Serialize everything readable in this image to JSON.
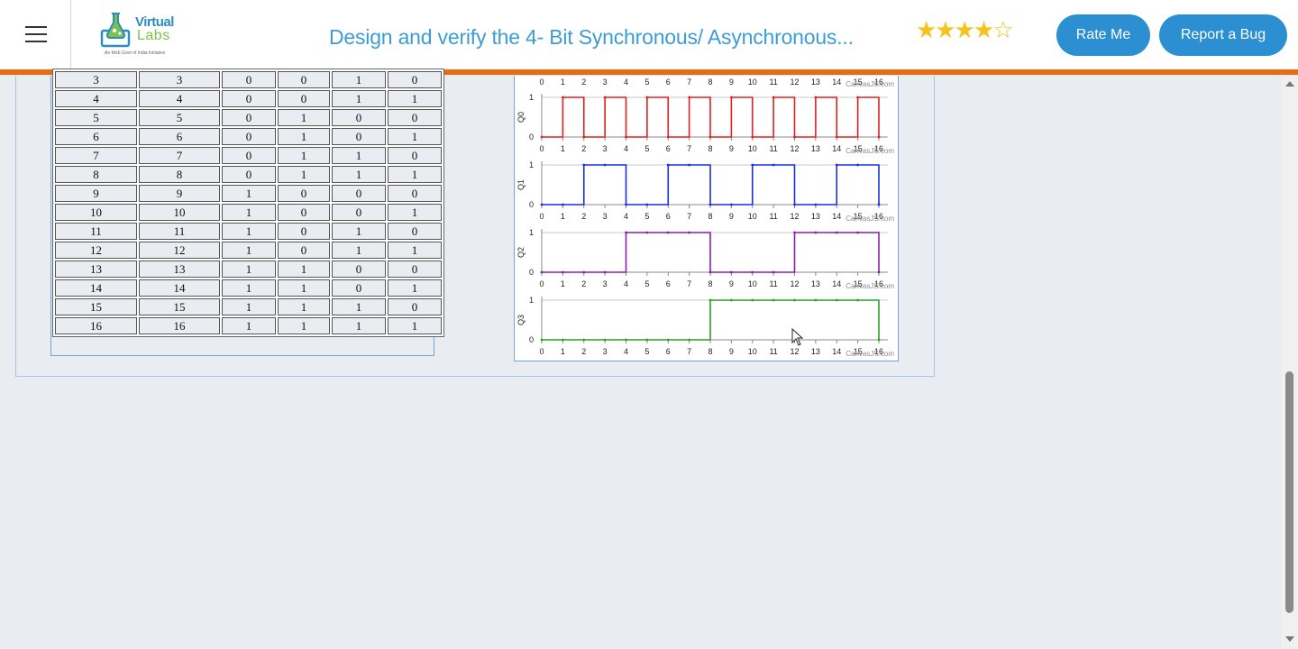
{
  "header": {
    "menu_icon": "hamburger-menu-icon",
    "logo": {
      "word1": "Virtual",
      "word2": "Labs",
      "tagline": "An MoE Govt of India Initiative"
    },
    "title": "Design and verify the 4- Bit Synchronous/ Asynchronous...",
    "rating": {
      "filled": 4,
      "total": 5,
      "filled_glyph": "★★★★",
      "empty_glyph": "☆"
    },
    "rate_button": "Rate Me",
    "bug_button": "Report a Bug",
    "colors": {
      "accent_bar": "#ec6a10",
      "button": "#2b8fd1",
      "title": "#3b9dd4",
      "star": "#f6c21c"
    }
  },
  "truth_table": {
    "rows": [
      [
        "3",
        "3",
        "0",
        "0",
        "1",
        "0"
      ],
      [
        "4",
        "4",
        "0",
        "0",
        "1",
        "1"
      ],
      [
        "5",
        "5",
        "0",
        "1",
        "0",
        "0"
      ],
      [
        "6",
        "6",
        "0",
        "1",
        "0",
        "1"
      ],
      [
        "7",
        "7",
        "0",
        "1",
        "1",
        "0"
      ],
      [
        "8",
        "8",
        "0",
        "1",
        "1",
        "1"
      ],
      [
        "9",
        "9",
        "1",
        "0",
        "0",
        "0"
      ],
      [
        "10",
        "10",
        "1",
        "0",
        "0",
        "1"
      ],
      [
        "11",
        "11",
        "1",
        "0",
        "1",
        "0"
      ],
      [
        "12",
        "12",
        "1",
        "0",
        "1",
        "1"
      ],
      [
        "13",
        "13",
        "1",
        "1",
        "0",
        "0"
      ],
      [
        "14",
        "14",
        "1",
        "1",
        "0",
        "1"
      ],
      [
        "15",
        "15",
        "1",
        "1",
        "1",
        "0"
      ],
      [
        "16",
        "16",
        "1",
        "1",
        "1",
        "1"
      ]
    ]
  },
  "chart_data": [
    {
      "type": "line",
      "step": true,
      "ylabel": "Q0",
      "color": "#e02020",
      "watermark": "CanvasJS.com",
      "x": [
        0,
        1,
        2,
        3,
        4,
        5,
        6,
        7,
        8,
        9,
        10,
        11,
        12,
        13,
        14,
        15,
        16
      ],
      "values": [
        0,
        1,
        0,
        1,
        0,
        1,
        0,
        1,
        0,
        1,
        0,
        1,
        0,
        1,
        0,
        1,
        0
      ],
      "ylim": [
        0,
        1
      ],
      "xlim": [
        0,
        16
      ],
      "xticks": [
        "0",
        "1",
        "2",
        "3",
        "4",
        "5",
        "6",
        "7",
        "8",
        "9",
        "10",
        "11",
        "12",
        "13",
        "14",
        "15",
        "16"
      ],
      "yticks": [
        "0",
        "1"
      ]
    },
    {
      "type": "line",
      "step": true,
      "ylabel": "Q1",
      "color": "#1a2ee0",
      "watermark": "CanvasJS.com",
      "x": [
        0,
        1,
        2,
        3,
        4,
        5,
        6,
        7,
        8,
        9,
        10,
        11,
        12,
        13,
        14,
        15,
        16
      ],
      "values": [
        0,
        0,
        1,
        1,
        0,
        0,
        1,
        1,
        0,
        0,
        1,
        1,
        0,
        0,
        1,
        1,
        0
      ],
      "ylim": [
        0,
        1
      ],
      "xlim": [
        0,
        16
      ],
      "xticks": [
        "0",
        "1",
        "2",
        "3",
        "4",
        "5",
        "6",
        "7",
        "8",
        "9",
        "10",
        "11",
        "12",
        "13",
        "14",
        "15",
        "16"
      ],
      "yticks": [
        "0",
        "1"
      ]
    },
    {
      "type": "line",
      "step": true,
      "ylabel": "Q2",
      "color": "#8a1eb0",
      "watermark": "CanvasJS.com",
      "x": [
        0,
        1,
        2,
        3,
        4,
        5,
        6,
        7,
        8,
        9,
        10,
        11,
        12,
        13,
        14,
        15,
        16
      ],
      "values": [
        0,
        0,
        0,
        0,
        1,
        1,
        1,
        1,
        0,
        0,
        0,
        0,
        1,
        1,
        1,
        1,
        0
      ],
      "ylim": [
        0,
        1
      ],
      "xlim": [
        0,
        16
      ],
      "xticks": [
        "0",
        "1",
        "2",
        "3",
        "4",
        "5",
        "6",
        "7",
        "8",
        "9",
        "10",
        "11",
        "12",
        "13",
        "14",
        "15",
        "16"
      ],
      "yticks": [
        "0",
        "1"
      ]
    },
    {
      "type": "line",
      "step": true,
      "ylabel": "Q3",
      "color": "#2aa02a",
      "watermark": "CanvasJS.com",
      "x": [
        0,
        1,
        2,
        3,
        4,
        5,
        6,
        7,
        8,
        9,
        10,
        11,
        12,
        13,
        14,
        15,
        16
      ],
      "values": [
        0,
        0,
        0,
        0,
        0,
        0,
        0,
        0,
        1,
        1,
        1,
        1,
        1,
        1,
        1,
        1,
        0
      ],
      "ylim": [
        0,
        1
      ],
      "xlim": [
        0,
        16
      ],
      "xticks": [
        "0",
        "1",
        "2",
        "3",
        "4",
        "5",
        "6",
        "7",
        "8",
        "9",
        "10",
        "11",
        "12",
        "13",
        "14",
        "15",
        "16"
      ],
      "yticks": [
        "0",
        "1"
      ]
    }
  ],
  "top_axis_ticks": [
    "0",
    "1",
    "2",
    "3",
    "4",
    "5",
    "6",
    "7",
    "8",
    "9",
    "10",
    "11",
    "12",
    "13",
    "14",
    "15",
    "16"
  ],
  "top_watermark": "CanvasJS.com"
}
